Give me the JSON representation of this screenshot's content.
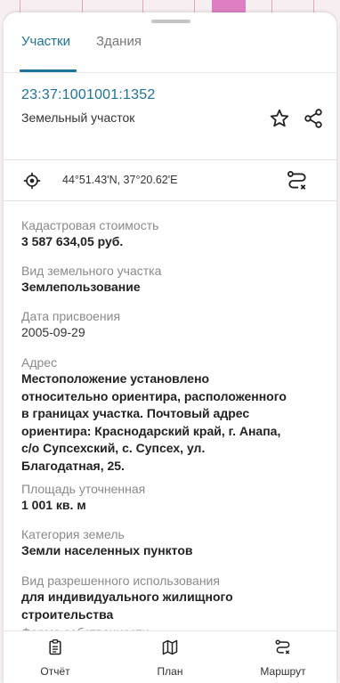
{
  "tabs": [
    {
      "label": "Участки",
      "active": true
    },
    {
      "label": "Здания",
      "active": false
    }
  ],
  "plot": {
    "cadastral_number": "23:37:1001001:1352",
    "type": "Земельный участок"
  },
  "coordinates": {
    "text": "44°51.43'N, 37°20.62'E"
  },
  "fields": [
    {
      "label": "Кадастровая стоимость",
      "value": "3 587 634,05 руб."
    },
    {
      "label": "Вид земельного участка",
      "value": "Землепользование"
    },
    {
      "label": "Дата присвоения",
      "value": "2005-09-29"
    },
    {
      "label": "Адрес",
      "value_lines": [
        "Местоположение установлено",
        "относительно ориентира, расположенного",
        "в границах участка. Почтовый адрес",
        "ориентира: Краснодарский край, г. Анапа,",
        "с/о Супсехский, с. Супсех, ул.",
        "Благодатная, 25."
      ]
    },
    {
      "label": "Площадь уточненная",
      "value": "1 001 кв. м"
    },
    {
      "label": "Категория земель",
      "value": "Земли населенных пунктов"
    },
    {
      "label": "Вид разрешенного использования",
      "value_lines": [
        "для индивидуального жилищного",
        "строительства"
      ]
    },
    {
      "label": "Форма собственности"
    }
  ],
  "bottom_nav": [
    {
      "label": "Отчёт",
      "icon": "report-icon"
    },
    {
      "label": "План",
      "icon": "map-icon"
    },
    {
      "label": "Маршрут",
      "icon": "route-icon"
    }
  ],
  "colors": {
    "accent": "#1e7398",
    "map_highlight": "#dd7fc2"
  }
}
